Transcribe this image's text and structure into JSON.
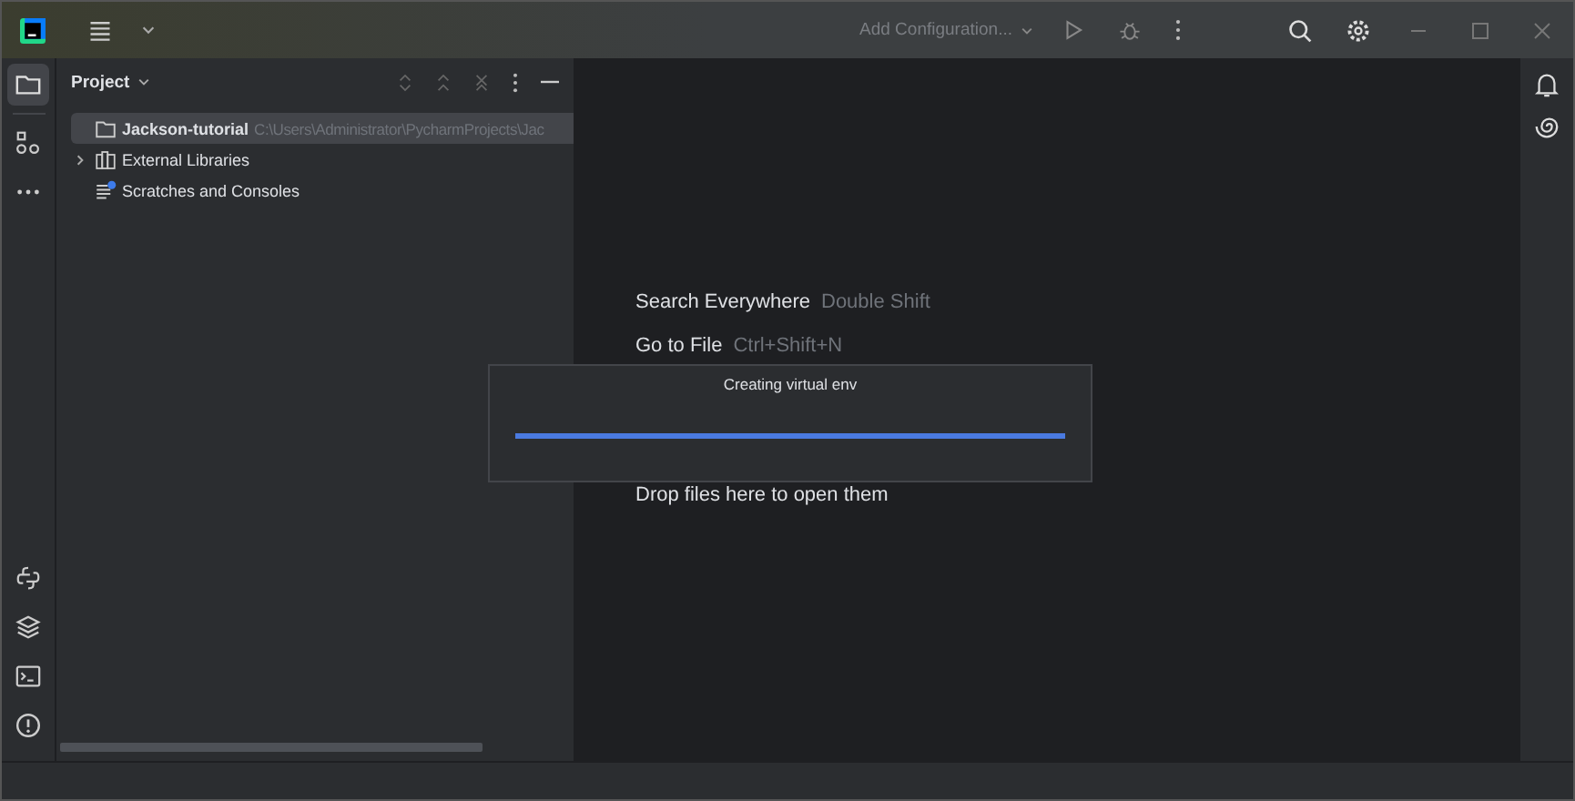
{
  "title_bar": {
    "run_config": "Add Configuration..."
  },
  "left_tools": [
    {
      "kind": "project",
      "selected": true
    },
    {
      "kind": "structure",
      "selected": false
    },
    {
      "kind": "more",
      "selected": false
    }
  ],
  "left_tools_bottom": [
    {
      "kind": "python"
    },
    {
      "kind": "layers"
    },
    {
      "kind": "terminal"
    },
    {
      "kind": "problems"
    }
  ],
  "right_tools": [
    {
      "kind": "bell"
    },
    {
      "kind": "swirl"
    }
  ],
  "project_panel": {
    "title": "Project",
    "tree": [
      {
        "label": "Jackson-tutorial",
        "detail": "C:\\Users\\Administrator\\PycharmProjects\\Jac",
        "kind": "folder",
        "bold": true,
        "selected": true
      },
      {
        "label": "External Libraries",
        "kind": "library",
        "bold": false,
        "selected": false,
        "expanded": false
      },
      {
        "label": "Scratches and Consoles",
        "kind": "scratch",
        "bold": false,
        "selected": false
      }
    ]
  },
  "editor_hints": [
    {
      "action": "Search Everywhere",
      "shortcut": "Double Shift"
    },
    {
      "action": "Go to File",
      "shortcut": "Ctrl+Shift+N"
    },
    {
      "action": "Drop files here to open them"
    }
  ],
  "progress_dialog": {
    "title": "Creating virtual env",
    "level": 1
  }
}
